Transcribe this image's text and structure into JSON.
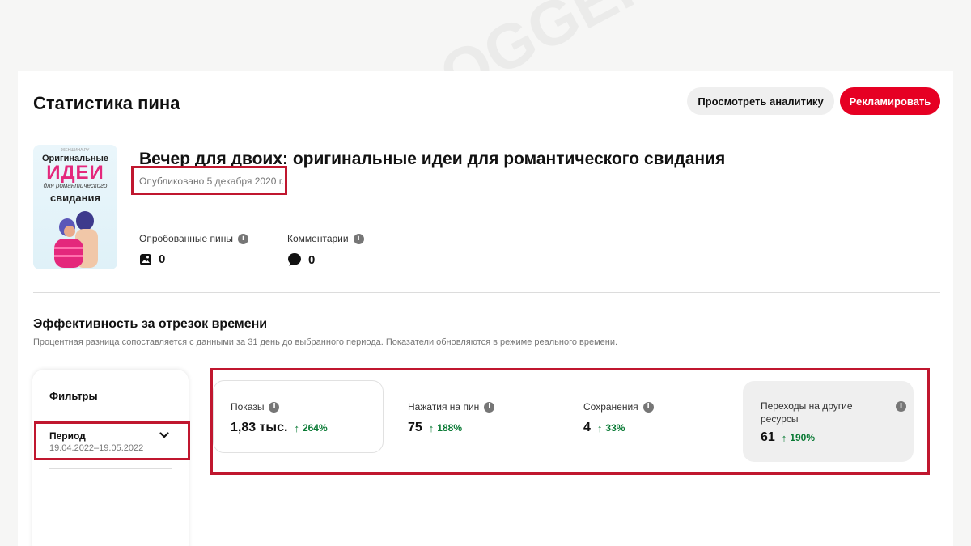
{
  "header": {
    "title": "Статистика пина",
    "analytics_button": "Просмотреть аналитику",
    "promote_button": "Рекламировать"
  },
  "pin": {
    "thumbnail": {
      "site": "ЖЕНЩИНА.РУ",
      "line1": "Оригинальные",
      "line2": "ИДЕИ",
      "line3": "для романтического",
      "line4": "свидания"
    },
    "title": "Вечер для двоих: оригинальные идеи для романтического свидания",
    "published": "Опубликовано 5 декабря 2020 г."
  },
  "engagement": {
    "tried_label": "Опробованные пины",
    "tried_value": "0",
    "comments_label": "Комментарии",
    "comments_value": "0"
  },
  "performance": {
    "title": "Эффективность за отрезок времени",
    "subtitle": "Процентная разница сопоставляется с данными за 31 день до выбранного периода. Показатели обновляются в режиме реального времени."
  },
  "filters": {
    "title": "Фильтры",
    "period_label": "Период",
    "period_value": "19.04.2022–19.05.2022"
  },
  "metrics": [
    {
      "label": "Показы",
      "value": "1,83 тыс.",
      "change": "264%"
    },
    {
      "label": "Нажатия на пин",
      "value": "75",
      "change": "188%"
    },
    {
      "label": "Сохранения",
      "value": "4",
      "change": "33%"
    },
    {
      "label": "Переходы на другие ресурсы",
      "value": "61",
      "change": "190%"
    }
  ],
  "watermark": "MARINAULABLOGGER",
  "colors": {
    "accent": "#e60023",
    "positive": "#0a7a35",
    "highlight": "#c0172f"
  }
}
